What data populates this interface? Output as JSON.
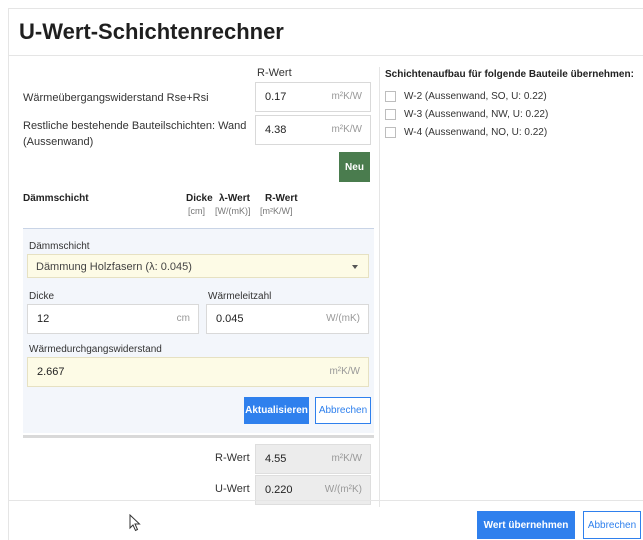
{
  "title": "U-Wert-Schichtenrechner",
  "top": {
    "rwert_header": "R-Wert",
    "rows": [
      {
        "label": "Wärmeübergangswiderstand Rse+Rsi",
        "value": "0.17",
        "unit": "m²K/W"
      },
      {
        "label_line1": "Restliche bestehende Bauteilschichten: Wand",
        "label_line2": "(Aussenwand)",
        "value": "4.38",
        "unit": "m²K/W"
      }
    ],
    "new_button": "Neu"
  },
  "table_header": {
    "col_layer": "Dämmschicht",
    "col_thickness": "Dicke",
    "col_thickness_unit": "[cm]",
    "col_lambda": "λ-Wert",
    "col_lambda_unit": "[W/(mK)]",
    "col_rwert": "R-Wert",
    "col_rwert_unit": "[m²K/W]"
  },
  "editor": {
    "layer_label": "Dämmschicht",
    "layer_value": "Dämmung Holzfasern (λ: 0.045)",
    "thickness_label": "Dicke",
    "thickness_value": "12",
    "thickness_unit": "cm",
    "conductivity_label": "Wärmeleitzahl",
    "conductivity_value": "0.045",
    "conductivity_unit": "W/(mK)",
    "resistance_label": "Wärmedurchgangswiderstand",
    "resistance_value": "2.667",
    "resistance_unit": "m²K/W",
    "update_button": "Aktualisieren",
    "cancel_button": "Abbrechen"
  },
  "results": {
    "rwert_label": "R-Wert",
    "rwert_value": "4.55",
    "rwert_unit": "m²K/W",
    "uwert_label": "U-Wert",
    "uwert_value": "0.220",
    "uwert_unit": "W/(m²K)"
  },
  "right_panel": {
    "title": "Schichtenaufbau für folgende Bauteile übernehmen:",
    "options": [
      "W-2 (Aussenwand, SO, U: 0.22)",
      "W-3 (Aussenwand, NW, U: 0.22)",
      "W-4 (Aussenwand, NO, U: 0.22)"
    ]
  },
  "footer": {
    "apply_button": "Wert übernehmen",
    "cancel_button": "Abbrechen"
  }
}
